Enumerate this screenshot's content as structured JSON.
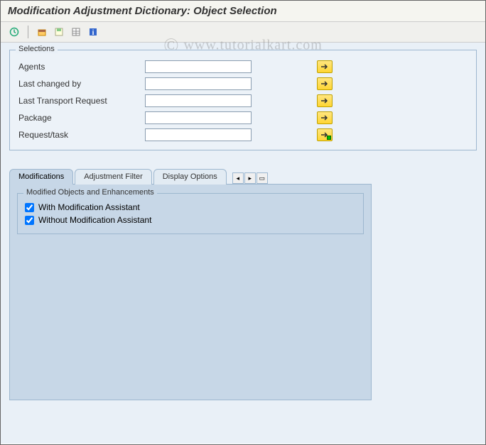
{
  "title": "Modification Adjustment Dictionary: Object Selection",
  "watermark": "www.tutorialkart.com",
  "selections": {
    "group_title": "Selections",
    "rows": [
      {
        "label": "Agents",
        "value": ""
      },
      {
        "label": "Last changed by",
        "value": ""
      },
      {
        "label": "Last Transport Request",
        "value": ""
      },
      {
        "label": "Package",
        "value": ""
      },
      {
        "label": "Request/task",
        "value": ""
      }
    ]
  },
  "tabs": {
    "items": [
      {
        "label": "Modifications",
        "active": true
      },
      {
        "label": "Adjustment Filter",
        "active": false
      },
      {
        "label": "Display Options",
        "active": false
      }
    ]
  },
  "modified_group": {
    "title": "Modified Objects and Enhancements",
    "checks": [
      {
        "label": "With Modification Assistant",
        "checked": true
      },
      {
        "label": "Without Modification Assistant",
        "checked": true
      }
    ]
  }
}
